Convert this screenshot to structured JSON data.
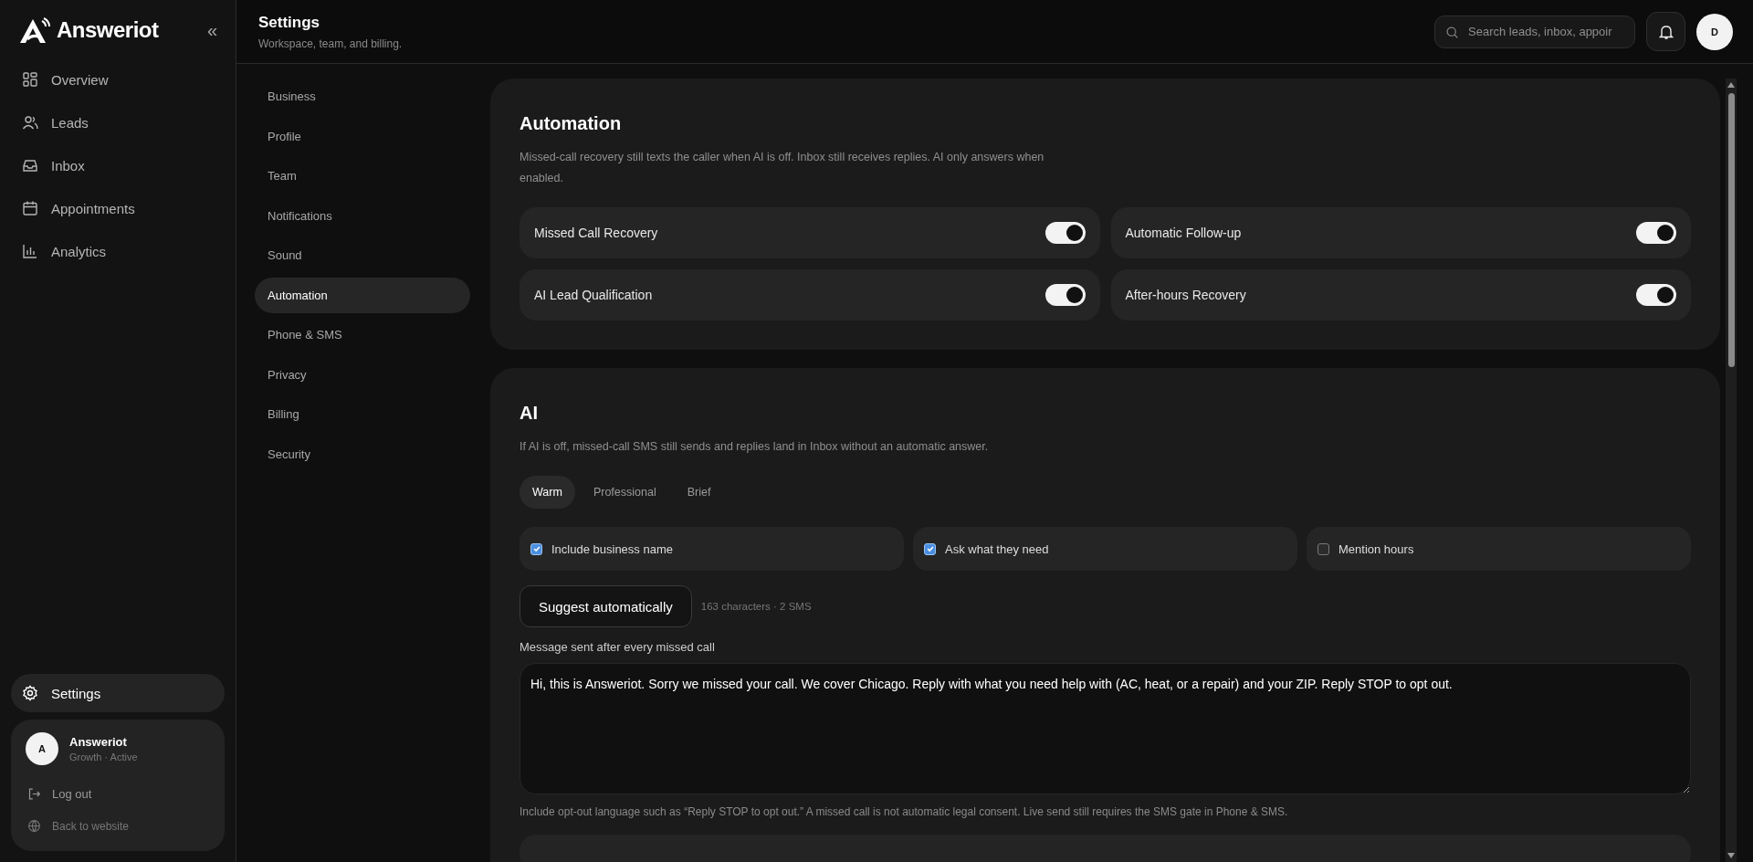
{
  "sidebar": {
    "logo": "Answeriot",
    "collapse": "«",
    "items": [
      {
        "label": "Overview",
        "kind": "grid",
        "selected": false
      },
      {
        "label": "Leads",
        "kind": "users",
        "selected": false
      },
      {
        "label": "Inbox",
        "kind": "inbox",
        "selected": false
      },
      {
        "label": "Appointments",
        "kind": "calendar",
        "selected": false
      },
      {
        "label": "Analytics",
        "kind": "chart",
        "selected": false
      }
    ],
    "settings": {
      "label": "Settings",
      "selected": true
    },
    "account": {
      "avatar": "A",
      "name": "Answeriot",
      "plan": "Growth · Active"
    },
    "links": [
      {
        "label": "Log out",
        "kind": "logout"
      },
      {
        "label": "Back to website",
        "kind": "globe"
      }
    ]
  },
  "header": {
    "title": "Settings",
    "subtitle": "Workspace, team, and billing.",
    "search": {
      "placeholder": "Search leads, inbox, appoir"
    },
    "avatar": "D"
  },
  "settings_nav": [
    {
      "label": "Business",
      "selected": false
    },
    {
      "label": "Profile",
      "selected": false
    },
    {
      "label": "Team",
      "selected": false
    },
    {
      "label": "Notifications",
      "selected": false
    },
    {
      "label": "Sound",
      "selected": false
    },
    {
      "label": "Automation",
      "selected": true
    },
    {
      "label": "Phone & SMS",
      "selected": false
    },
    {
      "label": "Privacy",
      "selected": false
    },
    {
      "label": "Billing",
      "selected": false
    },
    {
      "label": "Security",
      "selected": false
    }
  ],
  "automation": {
    "title": "Automation",
    "description": "Missed-call recovery still texts the caller when AI is off. Inbox still receives replies. AI only answers when enabled.",
    "toggles": [
      {
        "label": "Missed Call Recovery",
        "on": true
      },
      {
        "label": "Automatic Follow-up",
        "on": true
      },
      {
        "label": "AI Lead Qualification",
        "on": true
      },
      {
        "label": "After-hours Recovery",
        "on": true
      }
    ]
  },
  "ai": {
    "title": "AI",
    "description": "If AI is off, missed-call SMS still sends and replies land in Inbox without an automatic answer.",
    "tones": [
      {
        "label": "Warm",
        "selected": true
      },
      {
        "label": "Professional",
        "selected": false
      },
      {
        "label": "Brief",
        "selected": false
      }
    ],
    "options": [
      {
        "label": "Include business name",
        "checked": true
      },
      {
        "label": "Ask what they need",
        "checked": true
      },
      {
        "label": "Mention hours",
        "checked": false
      }
    ],
    "suggest_button": "Suggest automatically",
    "counter": "163 characters · 2 SMS",
    "message_label": "Message sent after every missed call",
    "message": "Hi, this is Answeriot. Sorry we missed your call. We cover Chicago. Reply with what you need help with (AC, heat, or a repair) and your ZIP. Reply STOP to opt out.",
    "note": "Include opt-out language such as “Reply STOP to opt out.” A missed call is not automatic legal consent. Live send still requires the SMS gate in Phone & SMS."
  }
}
